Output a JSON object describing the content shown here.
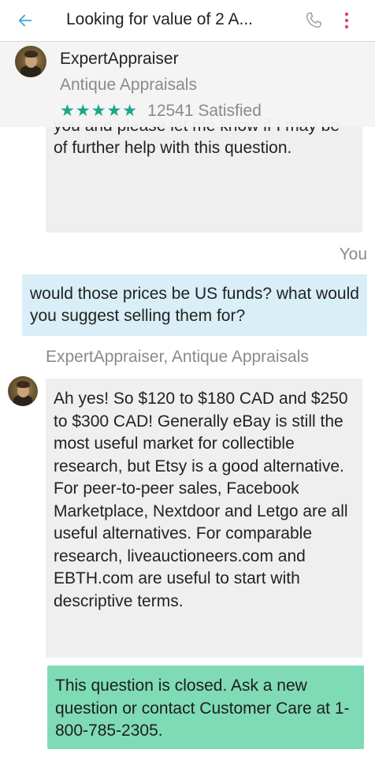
{
  "appbar": {
    "title": "Looking for value of 2 A...",
    "back_icon": "arrow-left-icon",
    "call_icon": "phone-icon",
    "more_icon": "more-vertical-icon"
  },
  "expert": {
    "name": "ExpertAppraiser",
    "category": "Antique Appraisals",
    "stars": "★★★★★",
    "satisfied": "12541 Satisfied"
  },
  "messages": [
    {
      "from": "expert",
      "text": "you and please let me know if I may be of further help with this question."
    },
    {
      "from": "user",
      "sender_label": "You",
      "text": "would those prices be US funds? what would you suggest selling them for?"
    },
    {
      "from": "expert",
      "sender_label": "ExpertAppraiser, Antique Appraisals",
      "text": "Ah yes! So $120 to $180 CAD and $250 to $300 CAD! Generally eBay is still the most useful market for collectible research, but Etsy is a good alternative. For peer-to-peer sales, Facebook Marketplace, Nextdoor and Letgo are all useful alternatives. For comparable research, liveauctioneers.com and EBTH.com are useful to start with descriptive terms."
    }
  ],
  "closed_notice": "This question is closed. Ask a new question or contact Customer Care at 1-800-785-2305.",
  "colors": {
    "accent": "#1aa789",
    "user_bubble": "#d9eef6",
    "expert_bubble": "#efefef",
    "closed_banner": "#7fdbb6",
    "back_arrow": "#3fa9d8"
  }
}
